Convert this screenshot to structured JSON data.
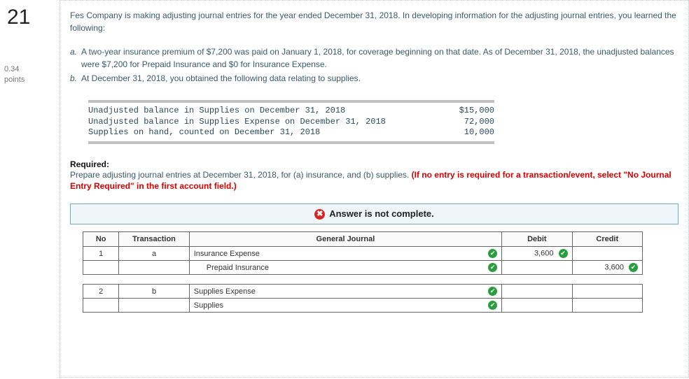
{
  "question_number": "21",
  "points_value": "0.34",
  "points_label": "points",
  "intro_text": "Fes Company is making adjusting journal entries for the year ended December 31, 2018. In developing information for the adjusting journal entries, you learned the following:",
  "items": {
    "a_label": "a.",
    "a_text": "A two-year insurance premium of $7,200 was paid on January 1, 2018, for coverage beginning on that date. As of December 31, 2018, the unadjusted balances were $7,200 for Prepaid Insurance and $0 for Insurance Expense.",
    "b_label": "b.",
    "b_text": "At December 31, 2018, you obtained the following data relating to supplies."
  },
  "supplies_data": [
    {
      "label": "Unadjusted balance in Supplies on December 31, 2018",
      "value": "$15,000"
    },
    {
      "label": "Unadjusted balance in Supplies Expense on December 31, 2018",
      "value": "72,000"
    },
    {
      "label": "Supplies on hand, counted on December 31, 2018",
      "value": "10,000"
    }
  ],
  "required_heading": "Required:",
  "required_text_plain": "Prepare adjusting journal entries at December 31, 2018, for (a) insurance, and (b) supplies. ",
  "required_text_warn": "(If no entry is required for a transaction/event, select \"No Journal Entry Required\" in the first account field.)",
  "feedback_text": "Answer is not complete.",
  "table": {
    "headers": {
      "no": "No",
      "transaction": "Transaction",
      "gj": "General Journal",
      "debit": "Debit",
      "credit": "Credit"
    },
    "rows": [
      {
        "no": "1",
        "trx": "a",
        "acct": "Insurance Expense",
        "indent": false,
        "ok": true,
        "debit": "3,600",
        "debit_ok": true,
        "credit": "",
        "credit_ok": false
      },
      {
        "no": "",
        "trx": "",
        "acct": "Prepaid Insurance",
        "indent": true,
        "ok": true,
        "debit": "",
        "debit_ok": false,
        "credit": "3,600",
        "credit_ok": true
      }
    ],
    "rows2": [
      {
        "no": "2",
        "trx": "b",
        "acct": "Supplies Expense",
        "indent": false,
        "ok": true,
        "debit": "",
        "debit_ok": false,
        "credit": "",
        "credit_ok": false
      },
      {
        "no": "",
        "trx": "",
        "acct": "Supplies",
        "indent": false,
        "ok": true,
        "debit": "",
        "debit_ok": false,
        "credit": "",
        "credit_ok": false
      }
    ]
  }
}
